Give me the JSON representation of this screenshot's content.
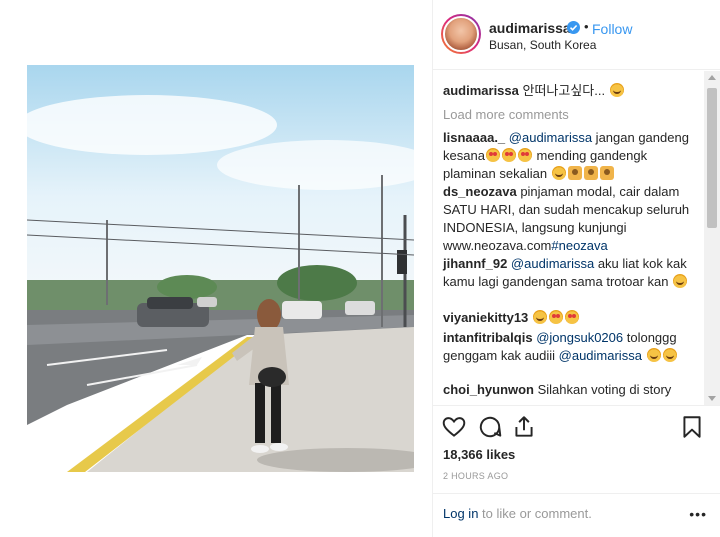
{
  "post": {
    "username": "audimarissa",
    "follow_label": "Follow",
    "separator": "•",
    "location": "Busan, South Korea",
    "verified_icon": "verified-badge-icon",
    "caption": {
      "user": "audimarissa",
      "text": "안떠나고싶다..."
    },
    "load_more": "Load more comments"
  },
  "comments": [
    {
      "user": "lisnaaaa._",
      "mention": "@audimarissa",
      "text_a": " jangan gandeng kesana",
      "text_b": " mending gandengk plaminan sekalian"
    },
    {
      "user": "ds_neozava",
      "text": " pinjaman modal, cair dalam SATU HARI, dan sudah mencakup seluruh INDONESIA, langsung kunjungi www.neozava.com",
      "hashtag": "#neozava"
    },
    {
      "user": "jihannf_92",
      "mention": "@audimarissa",
      "text": " aku liat kok kak kamu lagi gandengan sama trotoar kan"
    },
    {
      "user": "viyaniekitty13"
    },
    {
      "user": "intanfitribalqis",
      "mention": "@jongsuk0206",
      "text": " tolonggg genggam kak audiii ",
      "mention2": "@audimarissa"
    },
    {
      "user": "choi_hyunwon",
      "text": " Silahkan voting di story"
    }
  ],
  "actions": {
    "like_icon": "heart-icon",
    "comment_icon": "comment-icon",
    "share_icon": "share-icon",
    "save_icon": "bookmark-icon"
  },
  "likes": "18,366 likes",
  "timestamp": "2 HOURS AGO",
  "footer": {
    "login_link": "Log in",
    "login_text": " to like or comment.",
    "more": "•••"
  },
  "colors": {
    "link": "#3897f0",
    "mention": "#003569",
    "muted": "#999999",
    "text": "#262626"
  }
}
